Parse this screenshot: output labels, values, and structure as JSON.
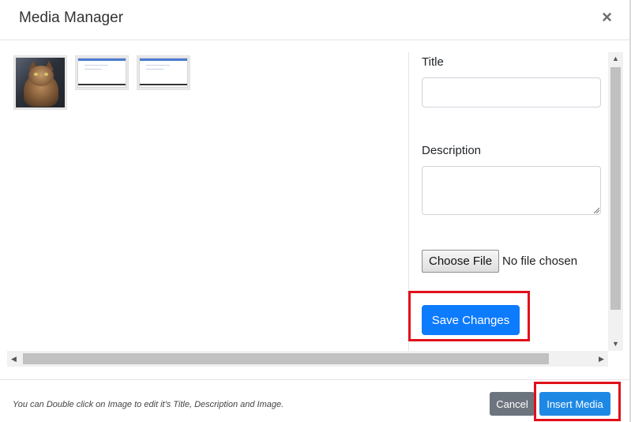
{
  "modal": {
    "title": "Media Manager",
    "close_label": "×"
  },
  "gallery": {
    "items": [
      {
        "type": "image",
        "icon": "cat-photo"
      },
      {
        "type": "image",
        "icon": "screenshot-thumbnail"
      },
      {
        "type": "image",
        "icon": "screenshot-thumbnail"
      }
    ]
  },
  "form": {
    "title_label": "Title",
    "title_value": "",
    "description_label": "Description",
    "description_value": "",
    "choose_file_label": "Choose File",
    "file_status": "No file chosen",
    "save_label": "Save Changes"
  },
  "footer": {
    "note": "You can Double click on Image to edit it's Title, Description and Image.",
    "cancel_label": "Cancel",
    "insert_label": "Insert Media"
  },
  "colors": {
    "primary": "#0d7bfd",
    "secondary": "#6c757d",
    "highlight": "#e0101a"
  }
}
